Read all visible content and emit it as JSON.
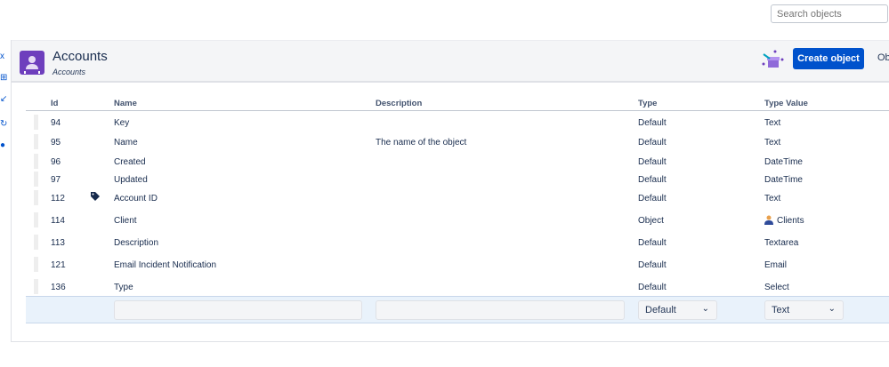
{
  "search": {
    "placeholder": "Search objects"
  },
  "header": {
    "title": "Accounts",
    "breadcrumb": "Accounts",
    "create_label": "Create object",
    "overflow_label": "Ob"
  },
  "columns": [
    "Id",
    "Name",
    "Description",
    "Type",
    "Type Value"
  ],
  "rows": [
    {
      "id": "94",
      "name": "Key",
      "description": "",
      "type": "Default",
      "type_value": "Text"
    },
    {
      "id": "95",
      "name": "Name",
      "description": "The name of the object",
      "type": "Default",
      "type_value": "Text"
    },
    {
      "id": "96",
      "name": "Created",
      "description": "",
      "type": "Default",
      "type_value": "DateTime"
    },
    {
      "id": "97",
      "name": "Updated",
      "description": "",
      "type": "Default",
      "type_value": "DateTime"
    },
    {
      "id": "112",
      "name": "Account ID",
      "description": "",
      "type": "Default",
      "type_value": "Text",
      "label_icon": "tag-icon"
    },
    {
      "id": "114",
      "name": "Client",
      "description": "",
      "type": "Object",
      "type_value": "Clients",
      "value_icon": "person-icon"
    },
    {
      "id": "113",
      "name": "Description",
      "description": "",
      "type": "Default",
      "type_value": "Textarea"
    },
    {
      "id": "121",
      "name": "Email Incident Notification",
      "description": "",
      "type": "Default",
      "type_value": "Email"
    },
    {
      "id": "136",
      "name": "Type",
      "description": "",
      "type": "Default",
      "type_value": "Select"
    }
  ],
  "new_row": {
    "type": "Default",
    "type_value": "Text"
  },
  "colors": {
    "accent": "#0052cc",
    "avatar": "#6e3fbd"
  }
}
